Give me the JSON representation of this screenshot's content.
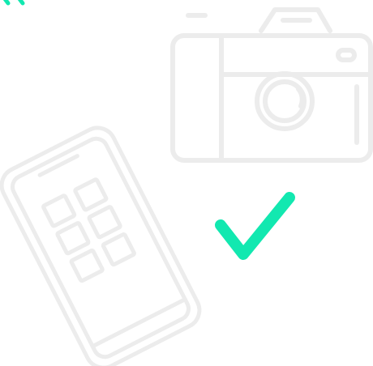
{
  "illustration": {
    "icons": {
      "corner_accent": "corner-accent-mark",
      "camera": "camera-icon",
      "phone": "smartphone-icon",
      "check": "checkmark-icon"
    },
    "colors": {
      "outline": "#ececec",
      "accent": "#12e8b0",
      "background": "#ffffff"
    }
  }
}
